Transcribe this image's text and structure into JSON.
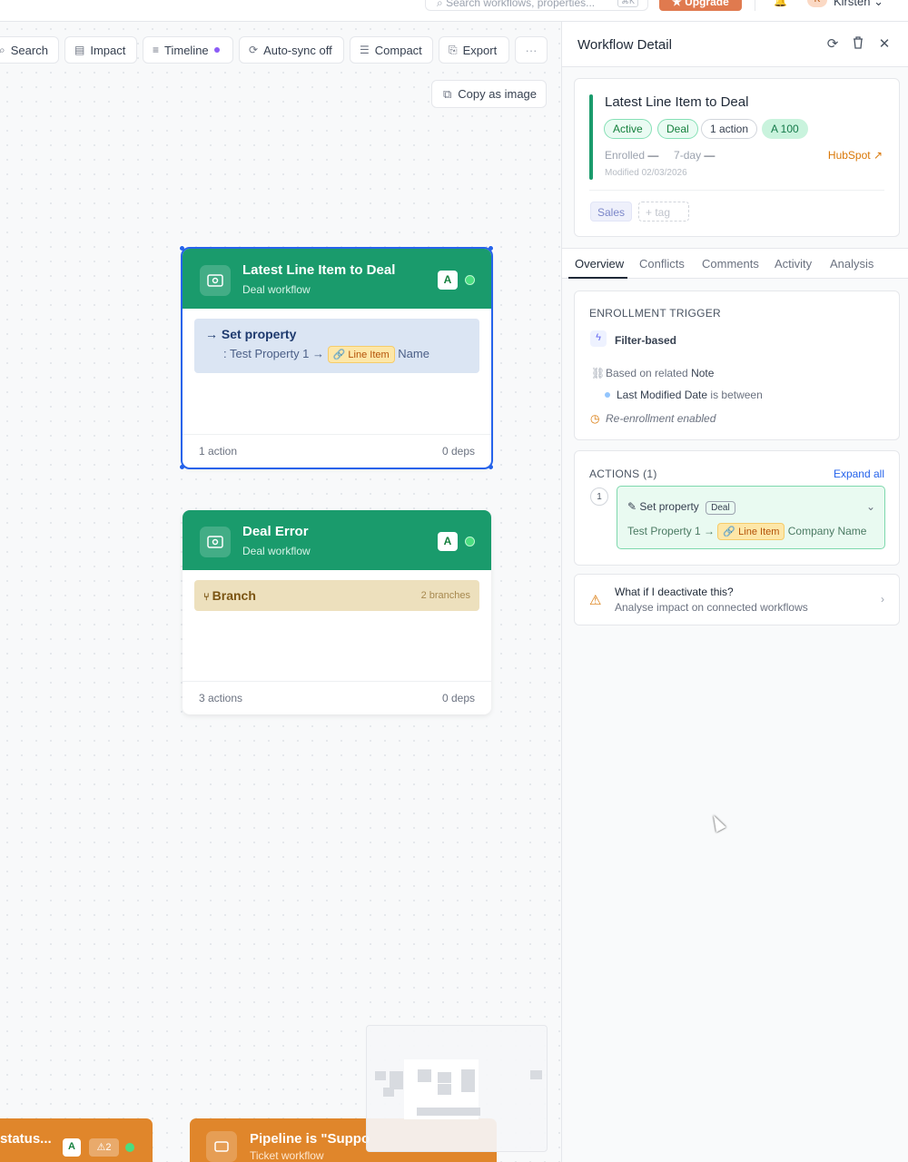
{
  "topbar": {
    "search_placeholder": "Search workflows, properties...",
    "search_shortcut": "⌘K",
    "upgrade_label": "★ Upgrade",
    "user_initial": "K",
    "user_name": "Kirsten ⌄"
  },
  "toolbar": {
    "search": "Search",
    "impact": "Impact",
    "timeline": "Timeline",
    "autosync": "Auto-sync off",
    "compact": "Compact",
    "export": "Export",
    "more": "···"
  },
  "canvas": {
    "copy_image": "Copy as image",
    "cards": [
      {
        "title": "Latest Line Item to Deal",
        "subtitle": "Deal workflow",
        "badge": "A",
        "action_title": "Set property",
        "action_desc_prefix": ": Test Property 1 →",
        "action_chip": "Line Item",
        "action_desc_suffix": "Name",
        "footer_left": "1 action",
        "footer_right": "0 deps"
      },
      {
        "title": "Deal Error",
        "subtitle": "Deal workflow",
        "badge": "A",
        "branch_label": "Branch",
        "branch_count": "2 branches",
        "footer_left": "3 actions",
        "footer_right": "0 deps"
      }
    ],
    "bottom_cards": [
      {
        "title": "status...",
        "badge": "A",
        "warnings": "⚠2"
      },
      {
        "title": "Pipeline is \"Suppo",
        "subtitle": "Ticket workflow"
      }
    ]
  },
  "panel": {
    "title": "Workflow Detail",
    "workflow_name": "Latest Line Item to Deal",
    "pills": [
      "Active",
      "Deal",
      "1 action",
      "A 100"
    ],
    "enrolled_label": "Enrolled",
    "enrolled_value": "—",
    "window_label": "7-day",
    "window_value": "—",
    "modified": "Modified 02/03/2026",
    "hubspot_link": "HubSpot ↗",
    "tags": [
      "Sales"
    ],
    "add_tag": "+ tag",
    "tabs": [
      "Overview",
      "Conflicts",
      "Comments",
      "Activity",
      "Analysis"
    ],
    "active_tab": "Overview",
    "trigger": {
      "heading": "ENROLLMENT TRIGGER",
      "type": "Filter-based",
      "related_prefix": "Based on related",
      "related_object": "Note",
      "filter_property": "Last Modified Date",
      "filter_operator": "is between",
      "reenroll": "Re-enrollment enabled"
    },
    "actions": {
      "heading": "ACTIONS (1)",
      "expand": "Expand all",
      "step_number": "1",
      "action_title": "Set property",
      "object_chip": "Deal",
      "desc_prefix": "Test Property 1 →",
      "desc_chip": "Line Item",
      "desc_suffix": "Company Name"
    },
    "deactivate": {
      "title": "What if I deactivate this?",
      "subtitle": "Analyse impact on connected workflows"
    }
  },
  "colors": {
    "deal_green": "#1a9b6c",
    "selection_blue": "#2563eb",
    "upgrade_orange": "#e07a4f",
    "ticket_orange": "#e0862b"
  }
}
